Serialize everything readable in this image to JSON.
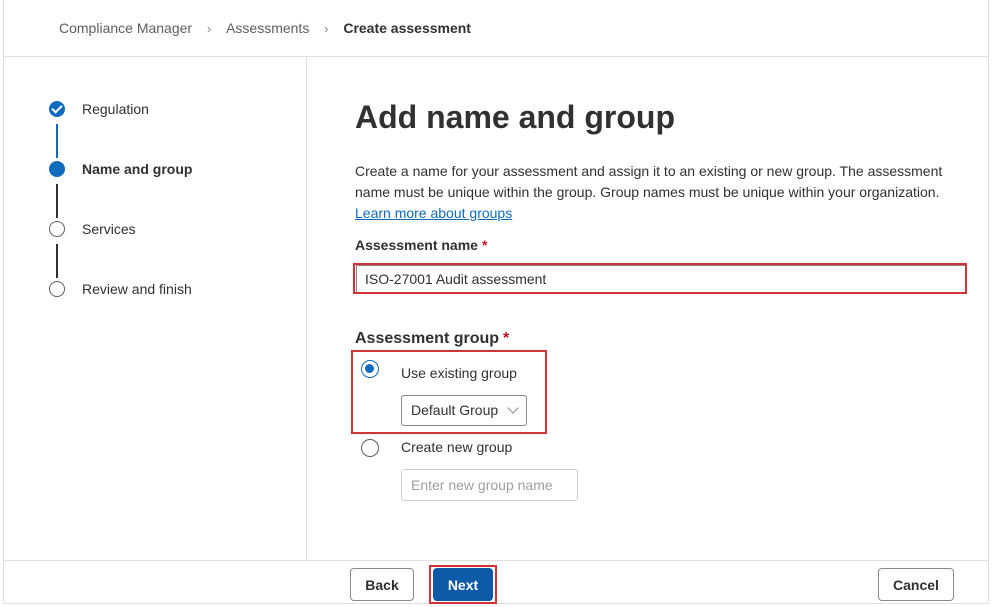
{
  "breadcrumb": {
    "items": [
      "Compliance Manager",
      "Assessments"
    ],
    "current": "Create assessment"
  },
  "stepper": {
    "steps": [
      {
        "label": "Regulation",
        "state": "completed"
      },
      {
        "label": "Name and group",
        "state": "current"
      },
      {
        "label": "Services",
        "state": "pending"
      },
      {
        "label": "Review and finish",
        "state": "pending"
      }
    ]
  },
  "main": {
    "title": "Add name and group",
    "description": "Create a name for your assessment and assign it to an existing or new group. The assessment name must be unique within the group. Group names must be unique within your organization.",
    "learn_more_link": "Learn more about groups",
    "assessment_name_label": "Assessment name",
    "required_mark": "*",
    "assessment_name_value": "ISO-27001 Audit assessment",
    "assessment_group_label": "Assessment group",
    "options": {
      "existing": {
        "label": "Use existing group",
        "selected": true
      },
      "new": {
        "label": "Create new group",
        "selected": false
      }
    },
    "group_select_value": "Default Group",
    "new_group_placeholder": "Enter new group name"
  },
  "footer": {
    "back_label": "Back",
    "next_label": "Next",
    "cancel_label": "Cancel"
  },
  "colors": {
    "accent": "#0f6cbd",
    "primary_button": "#0f5aa8",
    "highlight": "#d13438",
    "required": "#c50f1f"
  }
}
